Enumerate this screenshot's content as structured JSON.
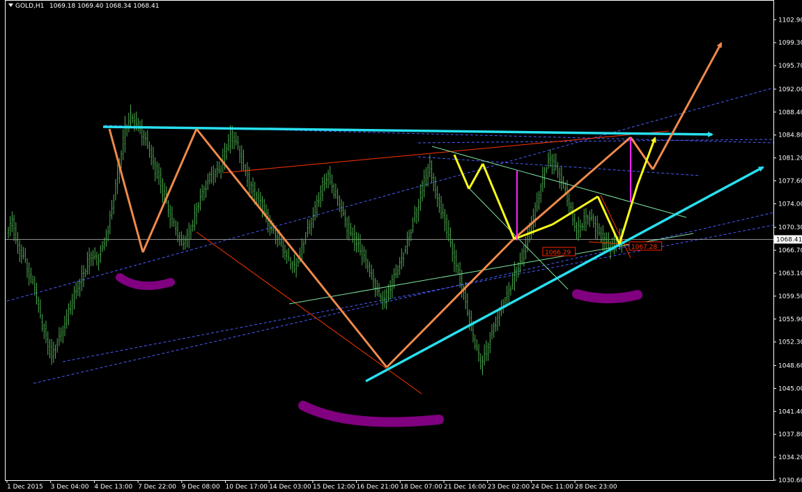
{
  "chart_data": {
    "type": "candlestick",
    "symbol_line": {
      "symbol": "GOLD,H1",
      "values": "1069.18 1069.40 1068.34 1068.41"
    },
    "ylim": [
      1030.6,
      1106.0
    ],
    "y_ticks": [
      "1102.90",
      "1099.30",
      "1095.70",
      "1092.00",
      "1088.40",
      "1084.80",
      "1081.20",
      "1077.60",
      "1074.00",
      "1070.30",
      "1066.70",
      "1063.10",
      "1059.50",
      "1055.90",
      "1052.30",
      "1048.60",
      "1045.00",
      "1041.40",
      "1037.80",
      "1034.20",
      "1030.60"
    ],
    "x_ticks": [
      "1 Dec 2015",
      "3 Dec 04:00",
      "4 Dec 13:00",
      "7 Dec 22:00",
      "9 Dec 08:00",
      "10 Dec 17:00",
      "14 Dec 03:00",
      "15 Dec 12:00",
      "16 Dec 21:00",
      "18 Dec 07:00",
      "21 Dec 16:00",
      "23 Dec 02:00",
      "24 Dec 11:00",
      "28 Dec 23:00"
    ],
    "current_price": "1068.41",
    "annotations": [
      "1066.29",
      "1067.28"
    ],
    "colors": {
      "background": "#000000",
      "candles": "#4caf50",
      "grid_axis": "#ffffff",
      "channel_dashed": "#4a5cff",
      "cyan_trend": "#28e0ef",
      "orange_zigzag": "#f08a4b",
      "yellow_zigzag": "#ffff1a",
      "purple_marks": "#800080",
      "magenta_lines": "#ff22ff",
      "red_lines": "#ff3300",
      "green_thin": "#7de3a0"
    },
    "price_path": [
      1069,
      1071,
      1067,
      1066,
      1063,
      1061,
      1056,
      1053,
      1050,
      1052,
      1054,
      1057,
      1060,
      1062,
      1064,
      1066,
      1065,
      1067,
      1070,
      1075,
      1080,
      1086,
      1088,
      1087,
      1085,
      1083,
      1080,
      1078,
      1075,
      1072,
      1070,
      1068,
      1069,
      1071,
      1074,
      1076,
      1078,
      1079,
      1080,
      1083,
      1085,
      1083,
      1080,
      1077,
      1075,
      1074,
      1072,
      1070,
      1069,
      1067,
      1065,
      1064,
      1066,
      1069,
      1071,
      1074,
      1077,
      1079,
      1076,
      1074,
      1071,
      1069,
      1068,
      1066,
      1064,
      1062,
      1060,
      1059,
      1061,
      1063,
      1065,
      1068,
      1071,
      1074,
      1078,
      1080,
      1076,
      1073,
      1070,
      1066,
      1063,
      1060,
      1056,
      1052,
      1049,
      1051,
      1054,
      1056,
      1058,
      1060,
      1063,
      1065,
      1068,
      1071,
      1074,
      1078,
      1081,
      1080,
      1078,
      1076,
      1073,
      1070,
      1071,
      1072,
      1071,
      1069,
      1068,
      1067,
      1068,
      1068.4
    ]
  }
}
